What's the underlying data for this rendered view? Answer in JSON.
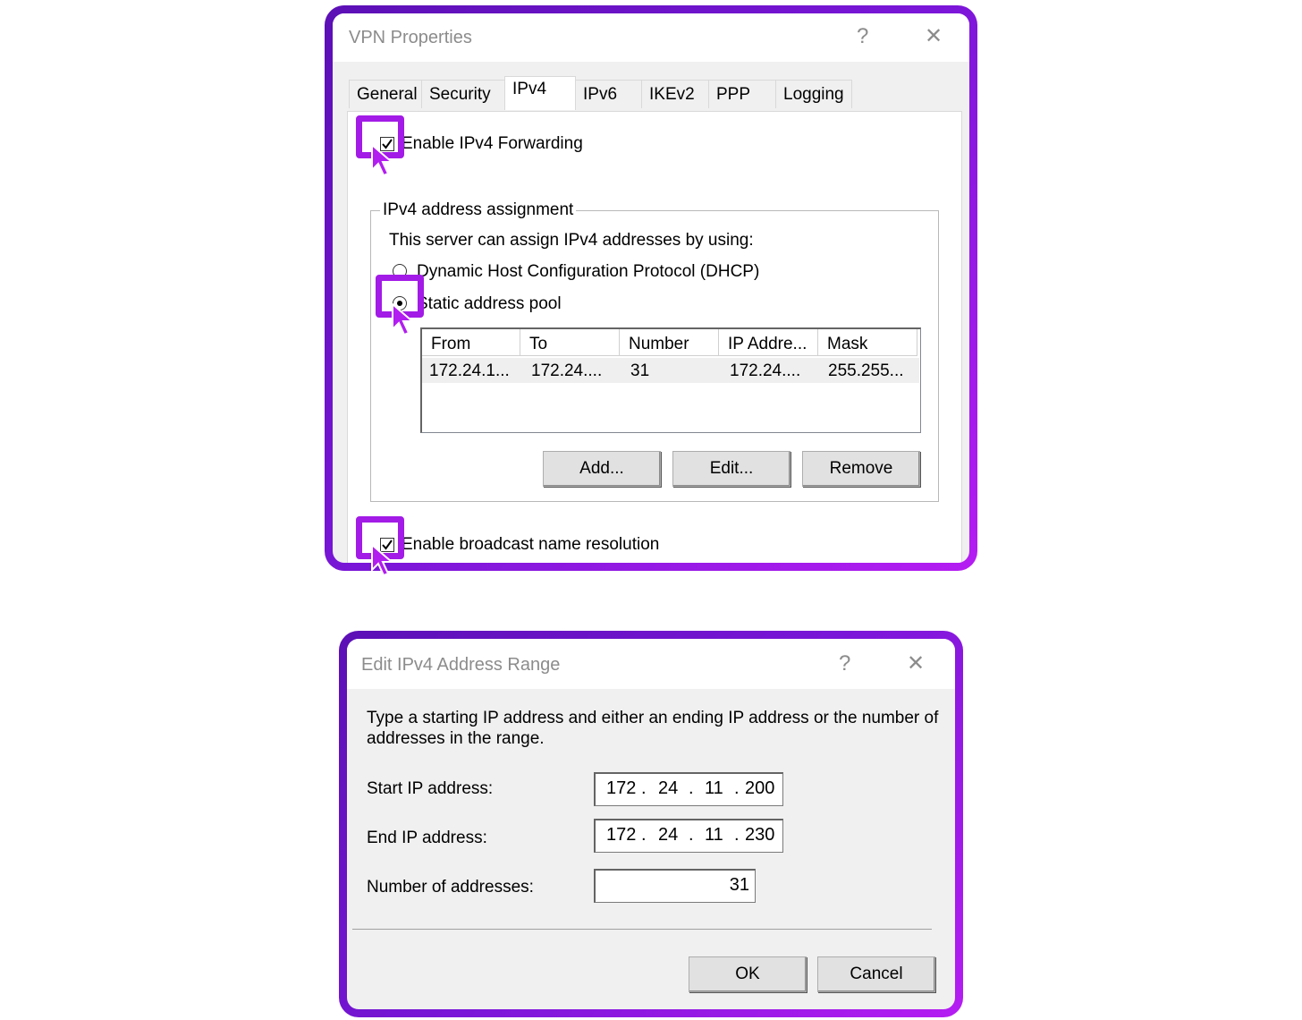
{
  "vpn_dialog": {
    "title": "VPN Properties",
    "help_glyph": "?",
    "close_glyph": "✕",
    "tabs": [
      "General",
      "Security",
      "IPv4",
      "IPv6",
      "IKEv2",
      "PPP",
      "Logging"
    ],
    "selected_tab": "IPv4",
    "enable_forwarding_label": "Enable IPv4 Forwarding",
    "enable_forwarding_checked": true,
    "group_label": "IPv4 address assignment",
    "assign_text": "This server can assign IPv4 addresses by using:",
    "dhcp_label": "Dynamic Host Configuration Protocol (DHCP)",
    "static_label": "Static address pool",
    "static_selected": true,
    "columns": [
      "From",
      "To",
      "Number",
      "IP Addre...",
      "Mask"
    ],
    "rows": [
      [
        "172.24.1...",
        "172.24....",
        "31",
        "172.24....",
        "255.255..."
      ]
    ],
    "add_label": "Add...",
    "edit_label": "Edit...",
    "remove_label": "Remove",
    "broadcast_label": "Enable broadcast name resolution",
    "broadcast_checked": true
  },
  "edit_dialog": {
    "title": "Edit IPv4 Address Range",
    "help_glyph": "?",
    "close_glyph": "✕",
    "instructions_line1": "Type a starting IP address and either an ending IP address or the number of",
    "instructions_line2": "addresses in the range.",
    "start_label": "Start IP address:",
    "start_ip": [
      "172",
      "24",
      "11",
      "200"
    ],
    "end_label": "End IP address:",
    "end_ip": [
      "172",
      "24",
      "11",
      "230"
    ],
    "count_label": "Number of addresses:",
    "count_value": "31",
    "ok_label": "OK",
    "cancel_label": "Cancel"
  },
  "colors": {
    "highlight": "#a21be6",
    "frame_start": "#5b10b5",
    "frame_end": "#b51df2"
  },
  "icons": [
    "checkmark-icon",
    "radio-dot-icon",
    "mouse-cursor-icon",
    "help-icon",
    "close-icon"
  ]
}
